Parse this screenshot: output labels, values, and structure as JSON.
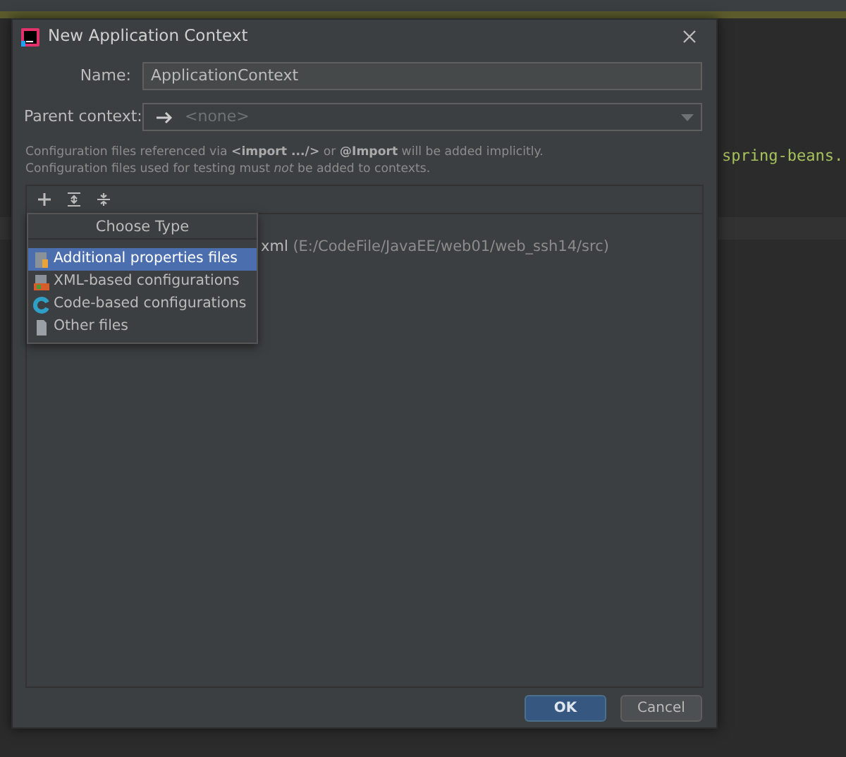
{
  "editor": {
    "code_fragment": "spring-beans."
  },
  "dialog": {
    "title": "New Application Context",
    "fields": [
      {
        "kind": "text",
        "label": "Name:",
        "value": "ApplicationContext"
      },
      {
        "kind": "combo",
        "label": "Parent context:",
        "value": "<none>"
      }
    ],
    "notes": [
      "Configuration files referenced via **<import .../>** or **@Import** will be added implicitly.",
      "Configuration files used for testing must *not* be added to contexts."
    ],
    "files": [
      {
        "name": "xml",
        "path": "(E:/CodeFile/JavaEE/web01/web_ssh14/src)"
      }
    ],
    "popup": {
      "title": "Choose Type",
      "items": [
        {
          "kind": "properties",
          "label": "Additional properties files",
          "selected": true
        },
        {
          "kind": "xml",
          "label": "XML-based configurations",
          "selected": false
        },
        {
          "kind": "code",
          "label": "Code-based configurations",
          "selected": false
        },
        {
          "kind": "other",
          "label": "Other files",
          "selected": false
        }
      ]
    },
    "buttons": [
      {
        "label": "OK",
        "default": true
      },
      {
        "label": "Cancel",
        "default": false
      }
    ]
  }
}
